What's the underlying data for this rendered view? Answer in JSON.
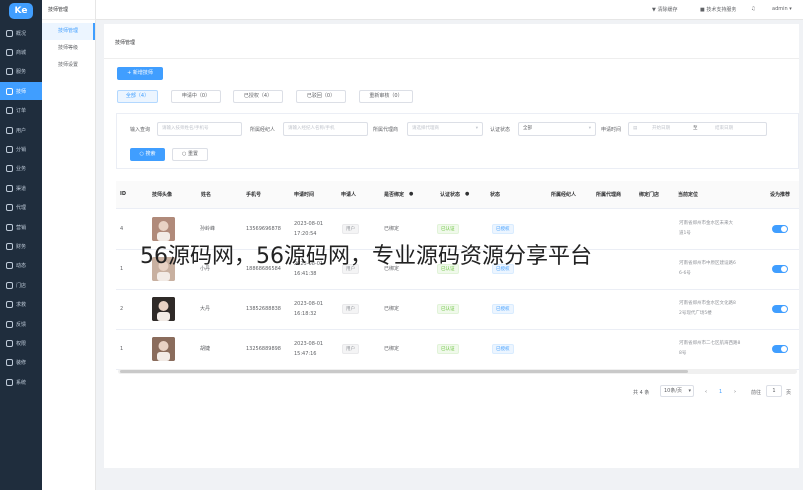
{
  "app": {
    "logo_text": "Ke"
  },
  "nav": {
    "items": [
      {
        "label": "概况",
        "icon": "home-icon"
      },
      {
        "label": "商城",
        "icon": "shop-icon"
      },
      {
        "label": "服务",
        "icon": "service-icon"
      },
      {
        "label": "技师",
        "icon": "technician-icon",
        "active": true
      },
      {
        "label": "订单",
        "icon": "order-icon"
      },
      {
        "label": "用户",
        "icon": "user-icon"
      },
      {
        "label": "分销",
        "icon": "distribution-icon"
      },
      {
        "label": "业务",
        "icon": "business-icon"
      },
      {
        "label": "渠道",
        "icon": "channel-icon"
      },
      {
        "label": "代理",
        "icon": "agent-icon"
      },
      {
        "label": "营销",
        "icon": "marketing-icon"
      },
      {
        "label": "财务",
        "icon": "finance-icon"
      },
      {
        "label": "动态",
        "icon": "feed-icon"
      },
      {
        "label": "门店",
        "icon": "store-icon"
      },
      {
        "label": "求救",
        "icon": "sos-icon"
      },
      {
        "label": "反馈",
        "icon": "feedback-icon"
      },
      {
        "label": "权限",
        "icon": "permission-icon"
      },
      {
        "label": "装修",
        "icon": "decoration-icon"
      },
      {
        "label": "系统",
        "icon": "system-icon"
      }
    ]
  },
  "subnav": {
    "title": "技师管理",
    "items": [
      {
        "label": "技师管理",
        "active": true
      },
      {
        "label": "技师等级"
      },
      {
        "label": "技师设置"
      }
    ]
  },
  "topbar": {
    "clear_cache": "清除缓存",
    "tech_support": "技术支持服务",
    "user": "admin"
  },
  "page": {
    "title": "技师管理",
    "add_button": "+ 新增技师"
  },
  "tabs": [
    {
      "label": "全部（4）",
      "active": true
    },
    {
      "label": "申请中（0）"
    },
    {
      "label": "已授权（4）"
    },
    {
      "label": "已驳回（0）"
    },
    {
      "label": "重新审核（0）"
    }
  ],
  "filters": {
    "name_label": "输入查询",
    "name_placeholder": "请输入技师姓名/手机号",
    "agent_label": "所属经纪人",
    "agent_placeholder": "请输入经纪人名称/手机",
    "proxy_label": "所属代理商",
    "proxy_value": "请选择代理商",
    "status_label": "认证状态",
    "status_value": "全部",
    "time_label": "申请时间",
    "start_placeholder": "开始日期",
    "range_sep": "至",
    "end_placeholder": "结束日期",
    "search_button": "搜索",
    "reset_button": "重置"
  },
  "table": {
    "columns": [
      "ID",
      "技师头像",
      "姓名",
      "手机号",
      "申请时间",
      "申请人",
      "是否绑定",
      "认证状态",
      "状态",
      "所属经纪人",
      "所属代理商",
      "绑定门店",
      "当前定位",
      "设为推荐"
    ],
    "rows": [
      {
        "id": "4",
        "name": "孙岭峰",
        "phone": "13569696878",
        "time1": "2023-08-01",
        "time2": "17:20:54",
        "applicant": "用户",
        "bound": "已绑定",
        "auth": "已认证",
        "status": "已授权",
        "location1": "河南省郑州市金水区未来大",
        "location2": "道1号"
      },
      {
        "id": "1",
        "name": "小丹",
        "phone": "18868686584",
        "time1": "2023-08-01",
        "time2": "16:41:38",
        "applicant": "用户",
        "bound": "已绑定",
        "auth": "已认证",
        "status": "已授权",
        "location1": "河南省郑州市中原区建设路6",
        "location2": "6-6号"
      },
      {
        "id": "2",
        "name": "大丹",
        "phone": "13852688838",
        "time1": "2023-08-01",
        "time2": "16:18:32",
        "applicant": "用户",
        "bound": "已绑定",
        "auth": "已认证",
        "status": "已授权",
        "location1": "河南省郑州市金水区文化路8",
        "location2": "2号现代广场5楼"
      },
      {
        "id": "1",
        "name": "胡婕",
        "phone": "13256889898",
        "time1": "2023-08-01",
        "time2": "15:47:16",
        "applicant": "用户",
        "bound": "已绑定",
        "auth": "已认证",
        "status": "已授权",
        "location1": "河南省郑州市二七区航海西路8",
        "location2": "8号"
      }
    ]
  },
  "pagination": {
    "total": "共 4 条",
    "page_size": "10条/页",
    "prev": "‹",
    "page": "1",
    "next": "›",
    "goto_label": "前往",
    "goto_value": "1",
    "page_unit": "页"
  },
  "watermark": "56源码网，56源码网，专业源码资源分享平台",
  "colors": {
    "primary": "#409eff",
    "sidebar": "#1f2d3d"
  }
}
